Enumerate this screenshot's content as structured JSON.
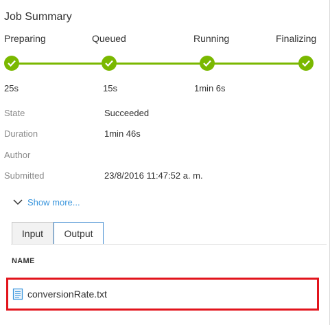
{
  "title": "Job Summary",
  "progress": {
    "stages": [
      {
        "label": "Preparing",
        "duration": "25s"
      },
      {
        "label": "Queued",
        "duration": "15s"
      },
      {
        "label": "Running",
        "duration": "1min 6s"
      },
      {
        "label": "Finalizing",
        "duration": ""
      }
    ],
    "stages_completed": 4
  },
  "properties": [
    {
      "label": "State",
      "value": "Succeeded"
    },
    {
      "label": "Duration",
      "value": "1min 46s"
    },
    {
      "label": "Author",
      "value": ""
    },
    {
      "label": "Submitted",
      "value": "23/8/2016 11:47:52 a. m."
    }
  ],
  "show_more": "Show more...",
  "tabs": [
    {
      "label": "Input",
      "selected": false
    },
    {
      "label": "Output",
      "selected": true
    }
  ],
  "outputs": {
    "column_header": "NAME",
    "files": [
      {
        "name": "conversionRate.txt",
        "icon": "file-icon"
      }
    ]
  },
  "colors": {
    "progress_green": "#7ab800",
    "link_blue": "#3a96dd",
    "highlight_red": "#e2141c",
    "tab_active_border": "#4f94d4"
  }
}
